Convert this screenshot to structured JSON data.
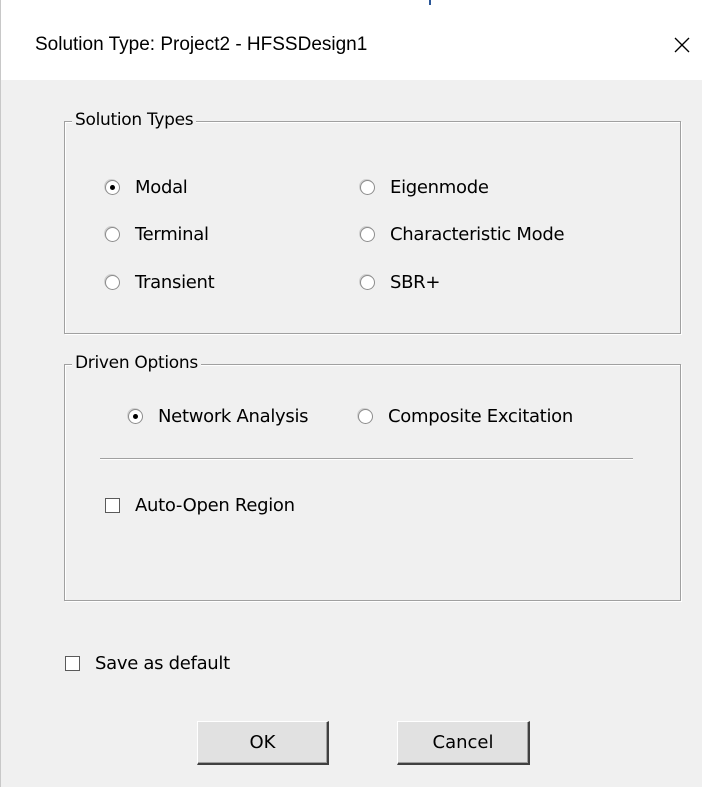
{
  "window": {
    "title": "Solution Type: Project2 - HFSSDesign1",
    "close_glyph": "×"
  },
  "solution_types": {
    "legend": "Solution Types",
    "options": [
      {
        "label": "Modal",
        "selected": true
      },
      {
        "label": "Terminal",
        "selected": false
      },
      {
        "label": "Transient",
        "selected": false
      },
      {
        "label": "Eigenmode",
        "selected": false
      },
      {
        "label": "Characteristic Mode",
        "selected": false
      },
      {
        "label": "SBR+",
        "selected": false
      }
    ]
  },
  "driven_options": {
    "legend": "Driven Options",
    "network_analysis": {
      "label": "Network Analysis",
      "selected": true
    },
    "composite_excitation": {
      "label": "Composite Excitation",
      "selected": false
    },
    "auto_open_region": {
      "label": "Auto-Open Region",
      "checked": false
    }
  },
  "save_as_default": {
    "label": "Save as default",
    "checked": false
  },
  "buttons": {
    "ok": "OK",
    "cancel": "Cancel"
  }
}
